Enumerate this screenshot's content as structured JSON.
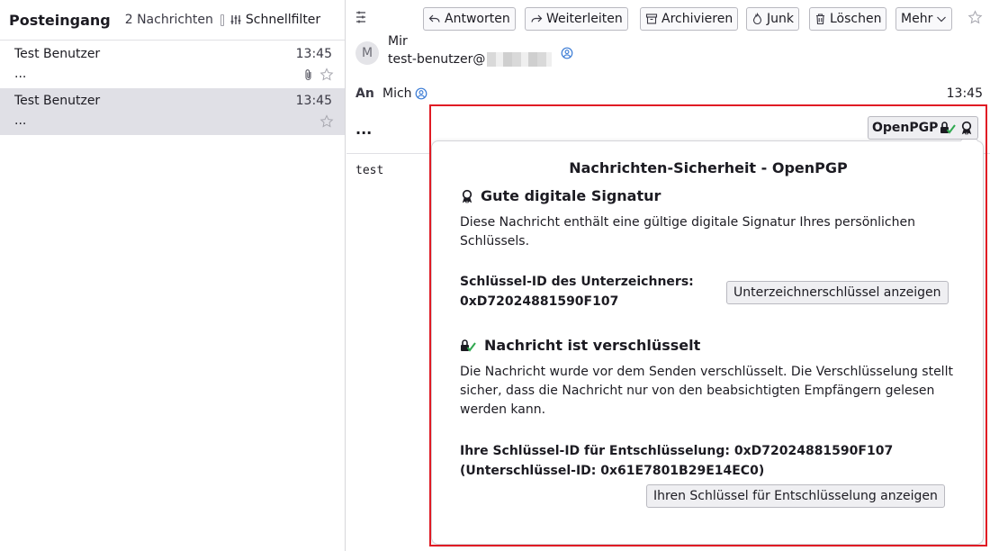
{
  "folder_pane": {
    "folder_name": "Posteingang",
    "message_count": "2 Nachrichten",
    "quick_filter_label": "Schnellfilter",
    "messages": [
      {
        "sender": "Test Benutzer",
        "time": "13:45",
        "subject": "...",
        "has_attachment": true,
        "selected": false
      },
      {
        "sender": "Test Benutzer",
        "time": "13:45",
        "subject": "...",
        "has_attachment": false,
        "selected": true
      }
    ]
  },
  "toolbar": {
    "reply": "Antworten",
    "forward": "Weiterleiten",
    "archive": "Archivieren",
    "junk": "Junk",
    "delete": "Löschen",
    "more": "Mehr"
  },
  "header": {
    "avatar_letter": "M",
    "from_name": "Mir",
    "from_email_prefix": "test-benutzer@",
    "to_label": "An",
    "to_name": "Mich",
    "time": "13:45",
    "subject": "...",
    "openpgp_label": "OpenPGP"
  },
  "body": {
    "text": "test"
  },
  "security_panel": {
    "title": "Nachrichten-Sicherheit - OpenPGP",
    "signature": {
      "heading": "Gute digitale Signatur",
      "description": "Diese Nachricht enthält eine gültige digitale Signatur Ihres persönlichen Schlüssels.",
      "signer_label": "Schlüssel-ID des Unterzeichners:",
      "signer_id": "0xD72024881590F107",
      "view_button": "Unterzeichnerschlüssel anzeigen"
    },
    "encryption": {
      "heading": "Nachricht ist verschlüsselt",
      "description": "Die Nachricht wurde vor dem Senden verschlüsselt. Die Verschlüsselung stellt sicher, dass die Nachricht nur von den beabsichtigten Empfängern gelesen werden kann.",
      "key_line": "Ihre Schlüssel-ID für Entschlüsselung: 0xD72024881590F107",
      "subkey_line": "(Unterschlüssel-ID: 0x61E7801B29E14EC0)",
      "view_button": "Ihren Schlüssel für Entschlüsselung anzeigen"
    }
  },
  "colors": {
    "highlight": "#e01b24",
    "selected_row": "#e0e0e6",
    "check_green": "#2fa84f",
    "contact_blue": "#3a7bd5"
  },
  "icons": [
    "menu-icon",
    "reply-icon",
    "forward-icon",
    "archive-icon",
    "junk-icon",
    "trash-icon",
    "chevron-down-icon",
    "star-icon",
    "attachment-icon",
    "contact-icon",
    "lock-check-icon",
    "seal-icon",
    "filter-icon"
  ]
}
